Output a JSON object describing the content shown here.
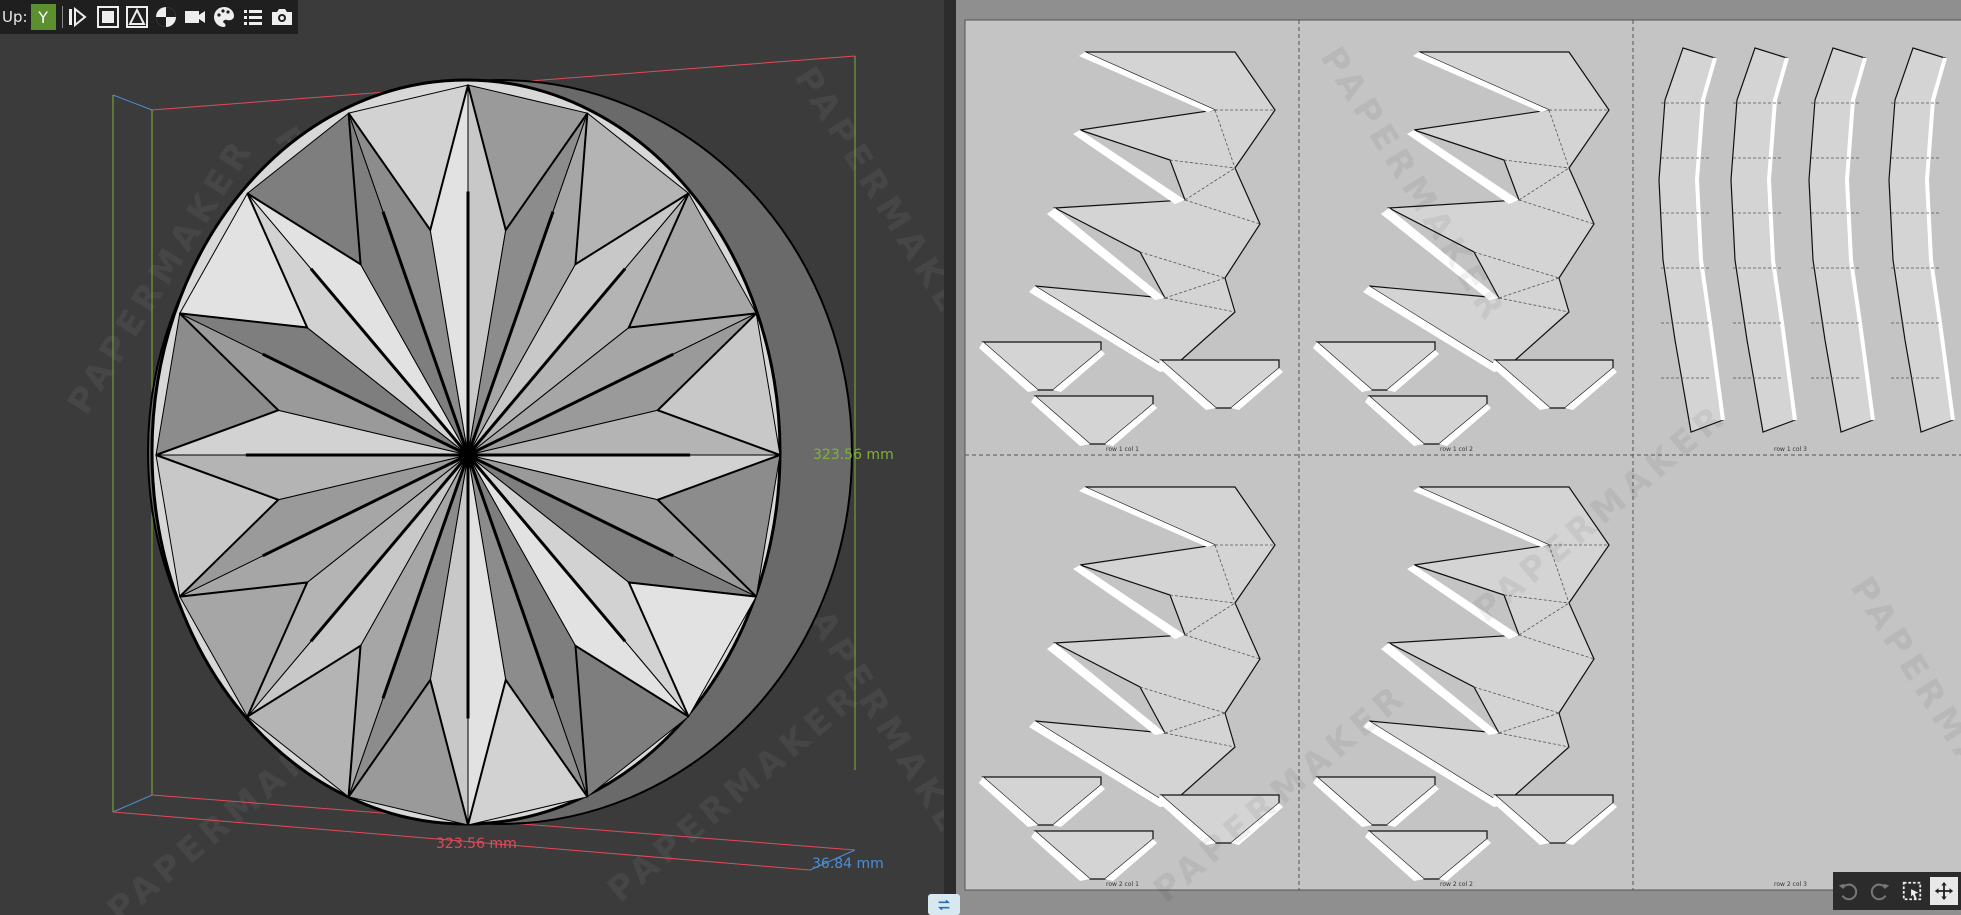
{
  "toolbar": {
    "up_label": "Up:",
    "axis_value": "Y",
    "buttons": [
      {
        "name": "flip-view-icon"
      },
      {
        "name": "face-mode-icon"
      },
      {
        "name": "edge-mode-icon"
      },
      {
        "name": "texture-mode-icon"
      },
      {
        "name": "video-camera-icon"
      },
      {
        "name": "palette-icon"
      },
      {
        "name": "list-icon"
      },
      {
        "name": "camera-icon"
      }
    ]
  },
  "dimensions": {
    "width": "323.56 mm",
    "height": "323.56 mm",
    "depth": "36.84 mm",
    "width_color": "#e04a5a",
    "height_color": "#7fb23a",
    "depth_color": "#4a8fd9"
  },
  "watermark": "PAPERMAKER",
  "sheets": [
    {
      "label": "row 1 col 1"
    },
    {
      "label": "row 1 col 2"
    },
    {
      "label": "row 1 col 3"
    },
    {
      "label": "row 2 col 1"
    },
    {
      "label": "row 2 col 2"
    },
    {
      "label": "row 2 col 3"
    }
  ],
  "bottom_toolbar": {
    "buttons": [
      {
        "name": "undo-icon"
      },
      {
        "name": "redo-icon"
      },
      {
        "name": "select-icon"
      },
      {
        "name": "move-icon"
      }
    ]
  },
  "colors": {
    "axis_active": "#5b8f2f",
    "viewport_bg": "#3b3b3b",
    "sheet_bg": "#c4c4c4"
  }
}
